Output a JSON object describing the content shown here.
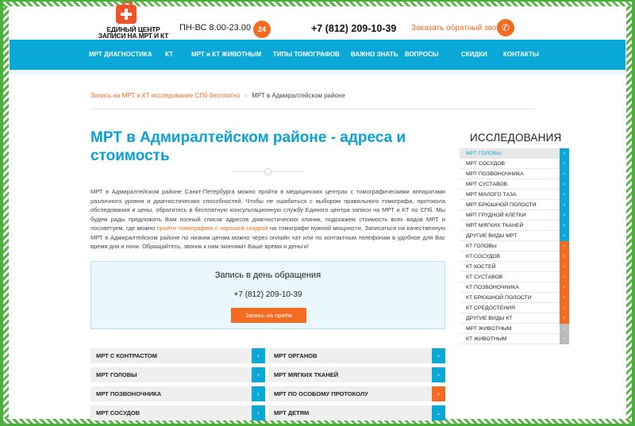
{
  "logo": {
    "line1": "ЕДИНЫЙ ЦЕНТР",
    "line2": "ЗАПИСИ НА МРТ И КТ"
  },
  "header": {
    "hours": "ПН-ВС 8.00-23.00",
    "badge": "24",
    "phone": "+7 (812) 209-10-39",
    "callback": "Заказать обратный звонок"
  },
  "nav": [
    "МРТ ДИАГНОСТИКА",
    "КТ",
    "МРТ и КТ ЖИВОТНЫМ",
    "ТИПЫ ТОМОГРАФОВ",
    "ВАЖНО ЗНАТЬ",
    "ВОПРОСЫ",
    "СКИДКИ",
    "КОНТАКТЫ"
  ],
  "breadcrumb": {
    "link": "Запись на МРТ и КТ исследование СПб бесплатно",
    "separator": "›",
    "current": "МРТ в Адмиралтейском районе"
  },
  "title": "МРТ в Адмиралтейском районе - адреса и стоимость",
  "intro": {
    "part1": "МРТ в Адмиралтейском районе Санкт-Петербурга можно пройти в медицинских центрах с томографическими аппаратами различного уровня и диагностических способностей. Чтобы не ошибиться с выбором правильного томографа, протокола обследования и цены, обратитесь в бесплатную консультационную службу Единого центра записи на МРТ и КТ по СПб. Мы будем рады предложить Вам полный список адресов диагностических клиник, подскажем стоимость всех видов МРТ и посоветуем, где можно ",
    "link": "пройти томографию с хорошей скидкой",
    "part2": " на томографе нужной мощности. Записаться на качественную МРТ в Адмиралтейском районе по низким ценам можно через онлайн чат или по контактным телефонам в удобное для Вас время дня и ночи. Обращайтесь, звонок к нам экономит Ваше время и деньги!"
  },
  "booking": {
    "title": "Запись в день обращения",
    "phone": "+7 (812) 209-10-39",
    "button": "Запись на приём"
  },
  "categories": [
    {
      "label": "МРТ С КОНТРАСТОМ",
      "arrow": "›",
      "color": "#0aa8d7"
    },
    {
      "label": "МРТ ОРГАНОВ",
      "arrow": "›",
      "color": "#0aa8d7"
    },
    {
      "label": "МРТ ГОЛОВЫ",
      "arrow": "›",
      "color": "#0aa8d7"
    },
    {
      "label": "МРТ МЯГКИХ ТКАНЕЙ",
      "arrow": "›",
      "color": "#0aa8d7"
    },
    {
      "label": "МРТ ПОЗВОНОЧНИКА",
      "arrow": "›",
      "color": "#0aa8d7"
    },
    {
      "label": "МРТ ПО ОСОБОМУ ПРОТОКОЛУ",
      "arrow": "›",
      "color": "#f26b21"
    },
    {
      "label": "МРТ СОСУДОВ",
      "arrow": "›",
      "color": "#0aa8d7"
    },
    {
      "label": "МРТ ДЕТЯМ",
      "arrow": "⌄",
      "color": "#0aa8d7"
    }
  ],
  "sidebar": {
    "heading": "ИССЛЕДОВАНИЯ",
    "items": [
      {
        "label": "МРТ ГОЛОВЫ",
        "color": "#0aa8d7",
        "active": true
      },
      {
        "label": "МРТ СОСУДОВ",
        "color": "#0aa8d7"
      },
      {
        "label": "МРТ ПОЗВОНОЧНИКА",
        "color": "#0aa8d7"
      },
      {
        "label": "МРТ СУСТАВОВ",
        "color": "#0aa8d7"
      },
      {
        "label": "МРТ МАЛОГО ТАЗА",
        "color": "#0aa8d7"
      },
      {
        "label": "МРТ БРЮШНОЙ ПОЛОСТИ",
        "color": "#0aa8d7"
      },
      {
        "label": "МРТ ГРУДНОЙ КЛЕТКИ",
        "color": "#0aa8d7"
      },
      {
        "label": "МРТ МЯГКИХ ТКАНЕЙ",
        "color": "#0aa8d7"
      },
      {
        "label": "ДРУГИЕ ВИДЫ МРТ",
        "color": "#0aa8d7"
      },
      {
        "label": "КТ ГОЛОВЫ",
        "color": "#f26b21"
      },
      {
        "label": "КТ СОСУДОВ",
        "color": "#f26b21"
      },
      {
        "label": "КТ КОСТЕЙ",
        "color": "#f26b21"
      },
      {
        "label": "КТ СУСТАВОВ",
        "color": "#f26b21"
      },
      {
        "label": "КТ ПОЗВОНОЧНИКА",
        "color": "#f26b21"
      },
      {
        "label": "КТ БРЮШНОЙ ПОЛОСТИ",
        "color": "#f26b21"
      },
      {
        "label": "КТ СРЕДОСТЕНИЯ",
        "color": "#f26b21"
      },
      {
        "label": "ДРУГИЕ ВИДЫ КТ",
        "color": "#f26b21"
      },
      {
        "label": "МРТ ЖИВОТНЫМ",
        "color": "#bbbbbb"
      },
      {
        "label": "КТ ЖИВОТНЫМ",
        "color": "#bbbbbb"
      }
    ]
  }
}
